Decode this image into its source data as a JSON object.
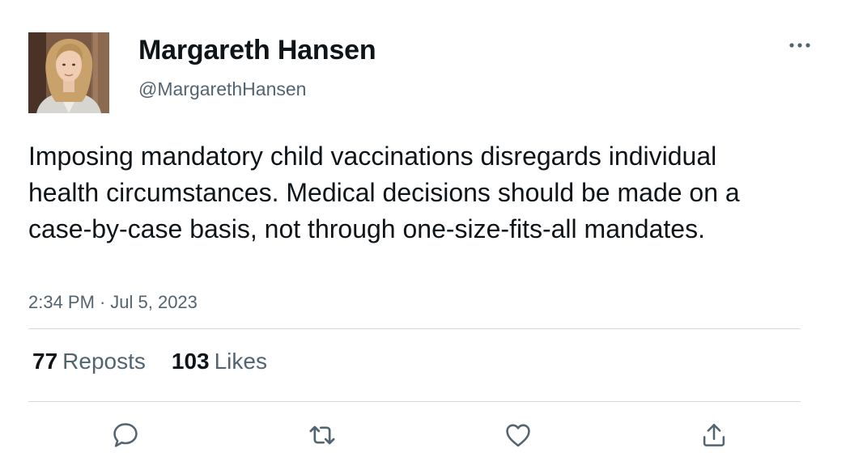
{
  "author": {
    "display_name": "Margareth Hansen",
    "handle": "@MargarethHansen",
    "avatar_icon": "profile-photo"
  },
  "tweet": {
    "text": "Imposing mandatory child vaccinations disregards individual health circumstances. Medical decisions should be made on a case-by-case basis, not through one-size-fits-all mandates.",
    "time": "2:34 PM",
    "separator": "·",
    "date": "Jul 5, 2023"
  },
  "stats": {
    "reposts_count": "77",
    "reposts_label": "Reposts",
    "likes_count": "103",
    "likes_label": "Likes"
  },
  "actions": {
    "reply_icon": "speech-bubble-icon",
    "repost_icon": "repost-arrows-icon",
    "like_icon": "heart-icon",
    "share_icon": "share-upload-icon",
    "more_icon": "three-dots-icon"
  },
  "colors": {
    "text_primary": "#0f1419",
    "text_secondary": "#536471",
    "divider": "#cfd9de",
    "icon": "#536471"
  }
}
